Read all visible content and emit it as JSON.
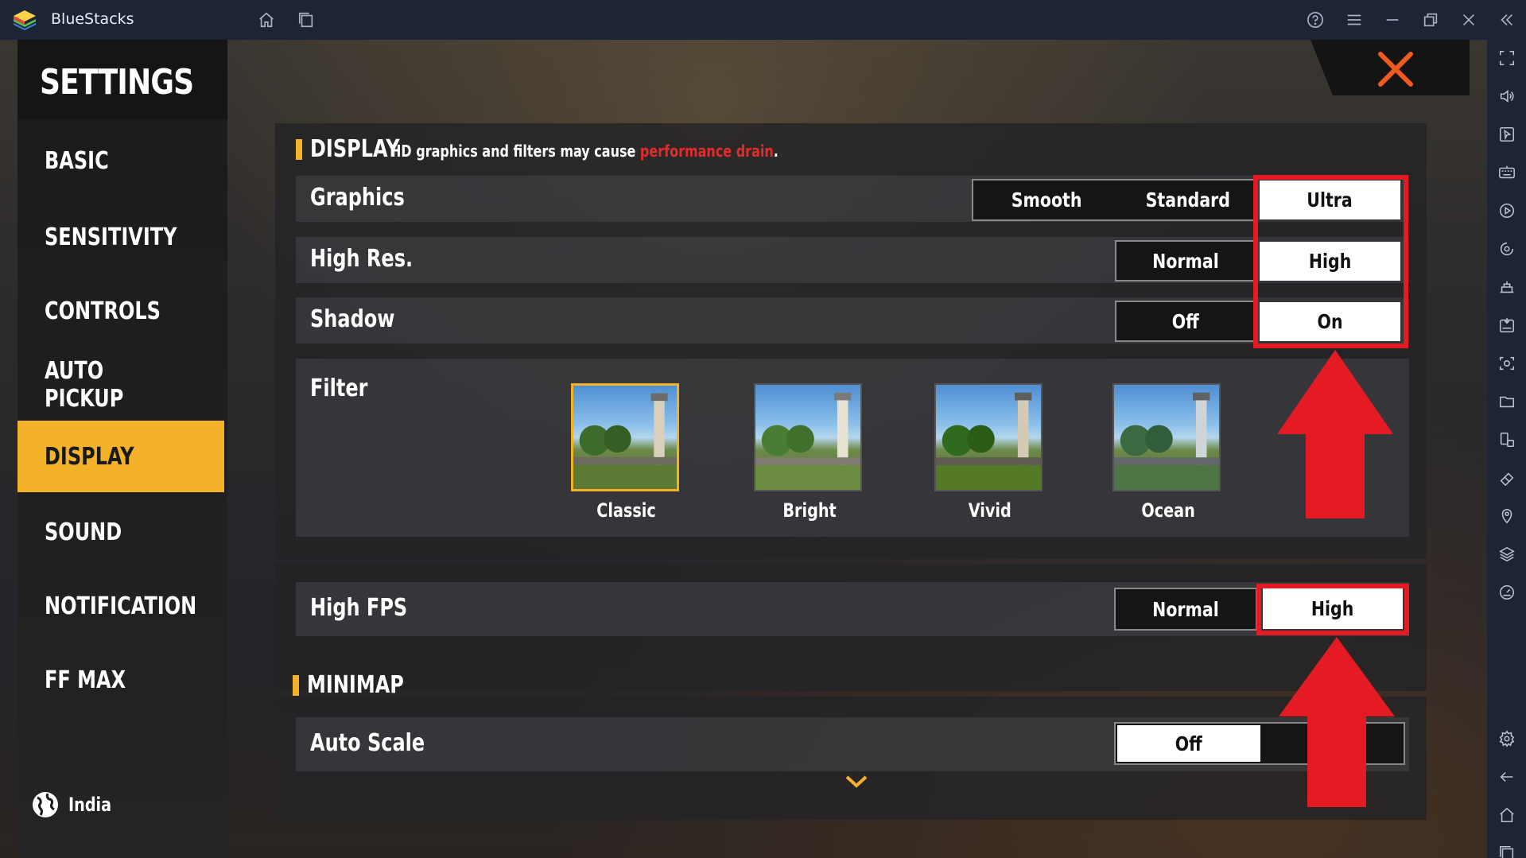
{
  "titlebar": {
    "app_name": "BlueStacks"
  },
  "settings": {
    "title": "SETTINGS",
    "menu": [
      {
        "label": "BASIC",
        "active": false
      },
      {
        "label": "SENSITIVITY",
        "active": false
      },
      {
        "label": "CONTROLS",
        "active": false
      },
      {
        "label": "AUTO PICKUP",
        "active": false
      },
      {
        "label": "DISPLAY",
        "active": true
      },
      {
        "label": "SOUND",
        "active": false
      },
      {
        "label": "NOTIFICATION",
        "active": false
      },
      {
        "label": "FF MAX",
        "active": false
      }
    ],
    "region": "India"
  },
  "display": {
    "title": "DISPLAY",
    "note": "HD graphics and filters may cause ",
    "note_warning": "performance drain",
    "note_end": ".",
    "graphics": {
      "label": "Graphics",
      "options": [
        "Smooth",
        "Standard",
        "Ultra"
      ],
      "selected": "Ultra"
    },
    "high_res": {
      "label": "High Res.",
      "options": [
        "Normal",
        "High"
      ],
      "selected": "High"
    },
    "shadow": {
      "label": "Shadow",
      "options": [
        "Off",
        "On"
      ],
      "selected": "On"
    },
    "filter": {
      "label": "Filter",
      "options": [
        "Classic",
        "Bright",
        "Vivid",
        "Ocean"
      ],
      "selected": "Classic"
    }
  },
  "fps": {
    "label": "High FPS",
    "options": [
      "Normal",
      "High"
    ],
    "selected": "High"
  },
  "minimap": {
    "title": "MINIMAP",
    "auto_scale": {
      "label": "Auto Scale",
      "value": "Off"
    }
  },
  "colors": {
    "accent": "#f3b22a",
    "highlight": "#e51b24",
    "warning_text": "#e12c2c",
    "titlebar": "#1d2436"
  }
}
